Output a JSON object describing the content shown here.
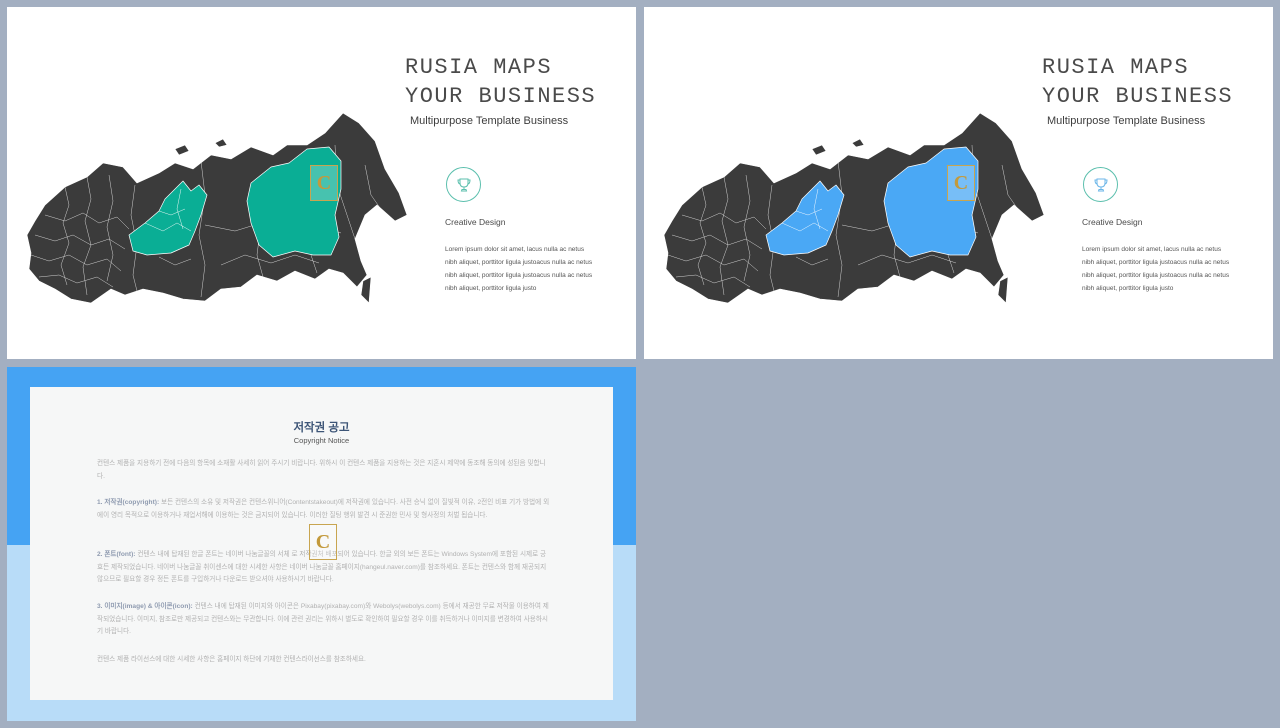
{
  "slides": [
    {
      "title_line1": "RUSIA MAPS",
      "title_line2": "YOUR BUSINESS",
      "subtitle": "Multipurpose Template Business",
      "feature_title": "Creative Design",
      "feature_body": "Lorem ipsum dolor sit amet, lacus nulla ac netus nibh aliquet, porttitor ligula justoacus nulla ac netus nibh aliquet, porttitor ligula justoacus nulla ac netus nibh aliquet, porttitor ligula justo",
      "highlight_color": "#0aae95",
      "trophy_icon": "trophy-icon"
    },
    {
      "title_line1": "RUSIA MAPS",
      "title_line2": "YOUR BUSINESS",
      "subtitle": "Multipurpose Template Business",
      "feature_title": "Creative Design",
      "feature_body": "Lorem ipsum dolor sit amet, lacus nulla ac netus nibh aliquet, porttitor ligula justoacus nulla ac netus nibh aliquet, porttitor ligula justoacus nulla ac netus nibh aliquet, porttitor ligula justo",
      "highlight_color": "#4aa8f5",
      "trophy_icon": "trophy-icon"
    }
  ],
  "map_base_color": "#3b3b3b",
  "watermark_letter": "C",
  "copyright": {
    "title": "저작권 공고",
    "subtitle": "Copyright Notice",
    "intro": "컨텐스 제품을 지용하기 전에 다음의 항목에 소재활 사세히 읽어 주시기 비랍니다. 위하시 이 컨텐스 제품을 지용하는 것은 지혼시 제약에 동조해 동의에 성된음 밎합니다.",
    "p1_head": "1. 저작권(copyright):",
    "p1_body": "보든 컨텐스의 소유 및 저작권은 컨텐스위니어(Contentstakeout)에 저작권에 있습니다. 사전 승닉 없이 질빛적 이유, 2전인 비표 기가 방법에 외에이 영리 목적으로 이용하거나 재업서해에 이용하는 것은 금지되어 있습니다. 이러한 질팅 행위 발견 시 준권한 민사 및 형사정의 처벌 됩습니다.",
    "p2_head": "2. 폰트(font):",
    "p2_body": "컨텐스 내에 탑재된 한글 폰트는 네이버 나눔글꼴의 서체 로 저작권처 배포되어 있습니다. 한글 외의 보든 폰트는 Windows System에 포함된 시제로 긍효든 제작되었습니다. 네이버 나눔글꼴 취이센스에 대한 시세한 사항은 네이버 나눔글꼴 홈페이지(hangeul.naver.com)를 참조하세요. 폰트는 컨텐스와 함께 재공되지 않으므로 필요할 경우 정든 폰트를 구입하거나 다운로드 받으셔야 사용하시기 바랍니다.",
    "p3_head": "3. 이미지(image) & 아이콘(icon):",
    "p3_body": "컨텐스 내에 탑재된 이미지와 아이콘은 Pixabay(pixabay.com)와 Webolys(webolys.com) 등에서 재공한 무료 저작물 이용하여 제작되었습니다. 이미지, 참조로만 제공되고 컨텐스와는 무관합니다. 이에 관련 권리는 위하시 별도로 확인하여 필요할 경우 이를 취득하거나 이미지를 변경하여 사용하시기 바랍니다.",
    "footer": "컨텐스 제품 라이선스에 대한 시세한 사항은 홈페이지 하단에 기재한 컨텐스라이선스를 참조하세요."
  }
}
